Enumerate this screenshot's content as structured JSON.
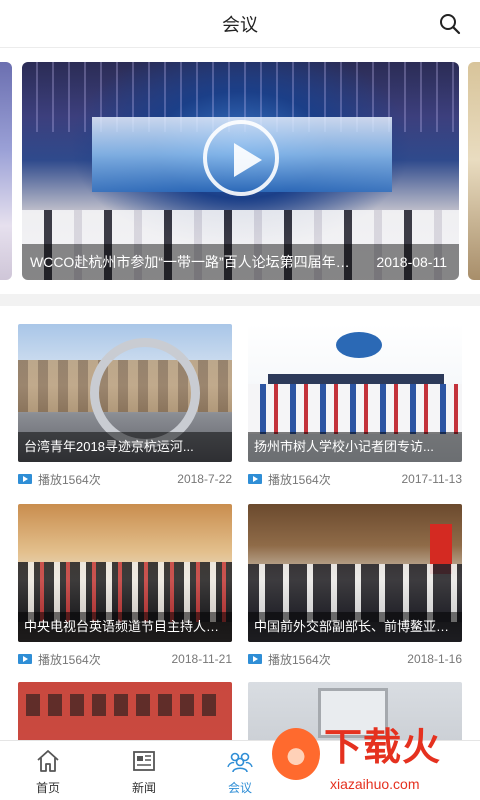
{
  "header": {
    "title": "会议"
  },
  "banner": {
    "title": "WCCO赴杭州市参加“一带一路”百人论坛第四届年会...",
    "date": "2018-08-11"
  },
  "cards": [
    {
      "title": "台湾青年2018寻迹京杭运河...",
      "plays": "播放1564次",
      "date": "2018-7-22"
    },
    {
      "title": "扬州市树人学校小记者团专访...",
      "plays": "播放1564次",
      "date": "2017-11-13"
    },
    {
      "title": "中央电视台英语频道节目主持人杨锐...",
      "plays": "播放1564次",
      "date": "2018-11-21"
    },
    {
      "title": "中国前外交部副部长、前博鳌亚洲...",
      "plays": "播放1564次",
      "date": "2018-1-16"
    }
  ],
  "tabs": [
    {
      "label": "首页"
    },
    {
      "label": "新闻"
    },
    {
      "label": "会议"
    }
  ],
  "watermark": {
    "text": "下载火",
    "sub": "xiazaihuo.com"
  },
  "colors": {
    "accent": "#2f8ed6",
    "watermark": "#e5311f"
  }
}
